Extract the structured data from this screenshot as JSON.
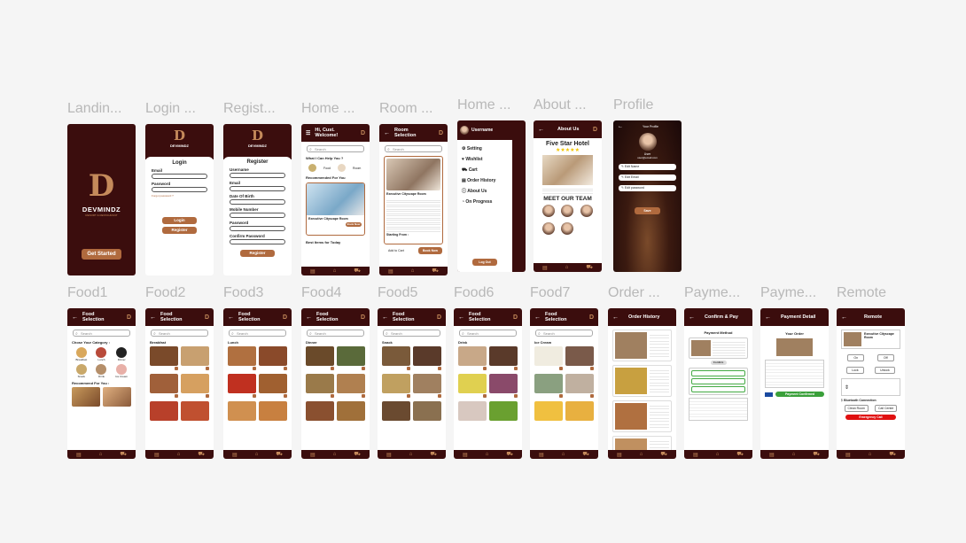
{
  "labels": {
    "landing": "Landin...",
    "login": "Login ...",
    "register": "Regist...",
    "home1": "Home ...",
    "room": "Room ...",
    "home2": "Home ...",
    "about": "About ...",
    "profile": "Profile",
    "food1": "Food1",
    "food2": "Food2",
    "food3": "Food3",
    "food4": "Food4",
    "food5": "Food5",
    "food6": "Food6",
    "food7": "Food7",
    "order": "Order ...",
    "payment1": "Payme...",
    "payment2": "Payme...",
    "remote": "Remote"
  },
  "brand": {
    "name": "DEVMINDZ",
    "tagline": "RESORT & RESTAURANT",
    "get_started": "Get Started"
  },
  "login": {
    "title": "Login",
    "email": "Email",
    "password": "Password",
    "forgot": "Forgot password ?",
    "login_btn": "Login",
    "register_btn": "Register"
  },
  "register": {
    "title": "Register",
    "fields": [
      "Username",
      "Email",
      "Date Of Birth",
      "Mobile Number",
      "Password",
      "Confirm Password"
    ],
    "submit": "Register"
  },
  "home": {
    "greeting": "Hi, Cust. Welcome!",
    "search": "Search",
    "help": "What I Can Help You ?",
    "cat_food": "Food",
    "cat_room": "Room",
    "recommended": "Recommended For You",
    "room_name": "Executive Cityscape Room",
    "best_items": "Best Items for Today",
    "book": "Book Now"
  },
  "room": {
    "title": "Room Selection",
    "room_name": "Executive Cityscape Room",
    "starting": "Starting From :",
    "add_cart": "Add to Cart",
    "book": "Book Now"
  },
  "menu": {
    "username": "Username",
    "items": [
      "Setting",
      "Wishlist",
      "Cart",
      "Order History",
      "About Us",
      "On Progress"
    ],
    "logout": "Log Out"
  },
  "about": {
    "title": "About Us",
    "hotel": "Five Star Hotel",
    "stars": "★★★★★",
    "team": "MEET OUR TEAM"
  },
  "profile": {
    "title": "Your Profile",
    "user": "User",
    "email": "user@email.com",
    "edit_name": "Edit Name",
    "edit_email": "Edit Email",
    "edit_password": "Edit password",
    "save": "Save"
  },
  "food": {
    "title": "Food Selection",
    "search": "Search",
    "category_title": "Chose Your Category :",
    "recommend": "Recommend For You :",
    "categories": [
      "Breakfast",
      "Lunch",
      "Dinner",
      "Snack",
      "Drink",
      "Ice Cream"
    ]
  },
  "order": {
    "title": "Order History"
  },
  "pay1": {
    "title": "Confirm & Pay",
    "method": "Payment Method",
    "confirm": "Confirm"
  },
  "pay2": {
    "title": "Payment Detail",
    "your_order": "Your Order",
    "confirm": "Payment Confirmed"
  },
  "remote": {
    "title": "Remote",
    "room": "Executive Cityscape Room",
    "on": "On",
    "off": "Off",
    "lock": "Lock",
    "unlock": "Unlock",
    "bluetooth": "Bluetooth Connection",
    "clean": "Clean Room",
    "call_center": "Call Center",
    "emergency": "Emergency Call"
  },
  "colors": {
    "maroon": "#3b0d0d",
    "accent": "#b06a3e",
    "label": "#b8b8b8"
  }
}
